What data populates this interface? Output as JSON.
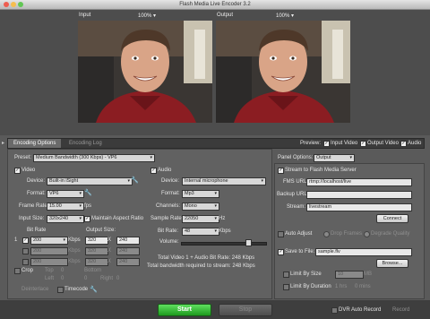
{
  "window": {
    "title": "Flash Media Live Encoder 3.2"
  },
  "input_preview": {
    "label": "Input",
    "zoom": "100%"
  },
  "output_preview": {
    "label": "Output",
    "zoom": "100%"
  },
  "tabs": {
    "encoding_options": "Encoding Options",
    "encoding_log": "Encoding Log"
  },
  "preview": {
    "label": "Preview:",
    "input_video": "Input Video",
    "output_video": "Output Video",
    "audio": "Audio"
  },
  "preset": {
    "label": "Preset:",
    "value": "Medium Bandwidth (300 Kbps) - VP6"
  },
  "video": {
    "label": "Video",
    "device_label": "Device:",
    "device": "Built-in iSight",
    "format_label": "Format:",
    "format": "VP6",
    "frame_rate_label": "Frame Rate:",
    "frame_rate": "15.00",
    "fps": "fps",
    "input_size_label": "Input Size:",
    "input_size": "320x240",
    "maintain_aspect": "Maintain Aspect Ratio",
    "bit_rate_label": "Bit Rate",
    "output_size_label": "Output Size:",
    "rows": [
      {
        "idx": "1",
        "rate": "200",
        "unit": "Kbps",
        "w": "320",
        "x": "X",
        "h": "240"
      },
      {
        "idx": "",
        "rate": "200",
        "unit": "Kbps",
        "w": "320",
        "x": "X",
        "h": "240"
      },
      {
        "idx": "",
        "rate": "200",
        "unit": "Kbps",
        "w": "320",
        "x": "X",
        "h": "240"
      }
    ],
    "crop": "Crop",
    "top": "Top",
    "bottom": "Bottom",
    "left": "Left",
    "right": "Right",
    "crop_top": "0",
    "crop_bottom": "0",
    "crop_left": "0",
    "crop_right": "0",
    "deinterlace": "Deinterlace",
    "timecode": "Timecode"
  },
  "audio": {
    "label": "Audio",
    "device_label": "Device:",
    "device": "Internal microphone",
    "format_label": "Format:",
    "format": "Mp3",
    "channels_label": "Channels:",
    "channels": "Mono",
    "sample_rate_label": "Sample Rate:",
    "sample_rate": "22050",
    "hz": "Hz",
    "bit_rate_label": "Bit Rate:",
    "bit_rate": "48",
    "kbps": "Kbps",
    "volume_label": "Volume:",
    "volume_level": 0.8
  },
  "totals": {
    "line1": "Total Video 1 + Audio Bit Rate: 248 Kbps",
    "line2": "Total bandwidth required to stream: 248 Kbps"
  },
  "panel_options": {
    "label": "Panel Options:",
    "value": "Output"
  },
  "server": {
    "stream_label": "Stream to Flash Media Server",
    "fms_url_label": "FMS URL:",
    "fms_url": "rtmp://localhost/live",
    "backup_url_label": "Backup URL:",
    "backup_url": "",
    "stream_name_label": "Stream:",
    "stream_name": "livestream",
    "connect": "Connect"
  },
  "auto": {
    "auto_adjust": "Auto Adjust",
    "drop_frames": "Drop Frames",
    "degrade_quality": "Degrade Quality"
  },
  "file": {
    "save_label": "Save to File:",
    "filename": "sample.flv",
    "browse": "Browse..."
  },
  "limits": {
    "size_label": "Limit By Size",
    "size_value": "10",
    "mb": "MB",
    "duration_label": "Limit By Duration",
    "hrs": "1 hrs",
    "min": "0 mins"
  },
  "bottom": {
    "start": "Start",
    "stop": "Stop",
    "dvr": "DVR Auto Record",
    "record": "Record"
  },
  "colors": {
    "start_green": "#2fbf2f",
    "panel_bg": "#616161"
  }
}
